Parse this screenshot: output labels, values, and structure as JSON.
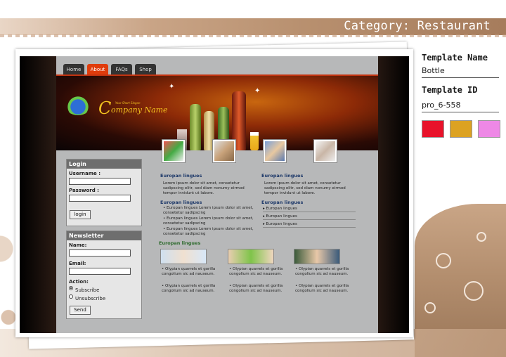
{
  "category": "Category: Restaurant",
  "info": {
    "template_name_label": "Template Name",
    "template_name_value": "Bottle",
    "template_id_label": "Template ID",
    "template_id_value": "pro_6-558",
    "swatches": [
      "#e8122a",
      "#dca222",
      "#ee88e6"
    ]
  },
  "site": {
    "nav": [
      "Home",
      "About",
      "FAQs",
      "Shop"
    ],
    "slogan": "Your Short Slogan",
    "company_initial": "C",
    "company_name": "ompany Name",
    "login": {
      "title": "Login",
      "username_label": "Username :",
      "password_label": "Password :",
      "button": "login"
    },
    "newsletter": {
      "title": "Newsletter",
      "name_label": "Name:",
      "email_label": "Email:",
      "action_label": "Action:",
      "subscribe": "Subscribe",
      "unsubscribe": "Unsubscribe",
      "button": "Send"
    },
    "col1_heading": "Europan lingues",
    "col1_text": "Lorem ipsum dolor sit amet, consetetur sadipscing elitr, sed diam nonumy eirmod tempor invidunt ut labore.",
    "col2_heading": "Europan lingues",
    "col2_text": "Lorem ipsum dolor sit amet, consetetur sadipscing elitr, sed diam nonumy eirmod tempor invidunt ut labore.",
    "list_heading": "Europan lingues",
    "bullets": [
      "Europan lingues Lorem ipsum dolor sit amet, consetetur sadipscing",
      "Europan lingues Lorem ipsum dolor sit amet, consetetur sadipscing",
      "Europan lingues Lorem ipsum dolor sit amet, consetetur sadipscing"
    ],
    "links_heading": "Europan lingues",
    "links": [
      "Europan lingues",
      "Europan lingues",
      "Europan lingues"
    ],
    "gallery_heading": "Europan lingues",
    "gallery_caption": "Olypian quarrels et gorilla congolium sic ad nauseum."
  }
}
